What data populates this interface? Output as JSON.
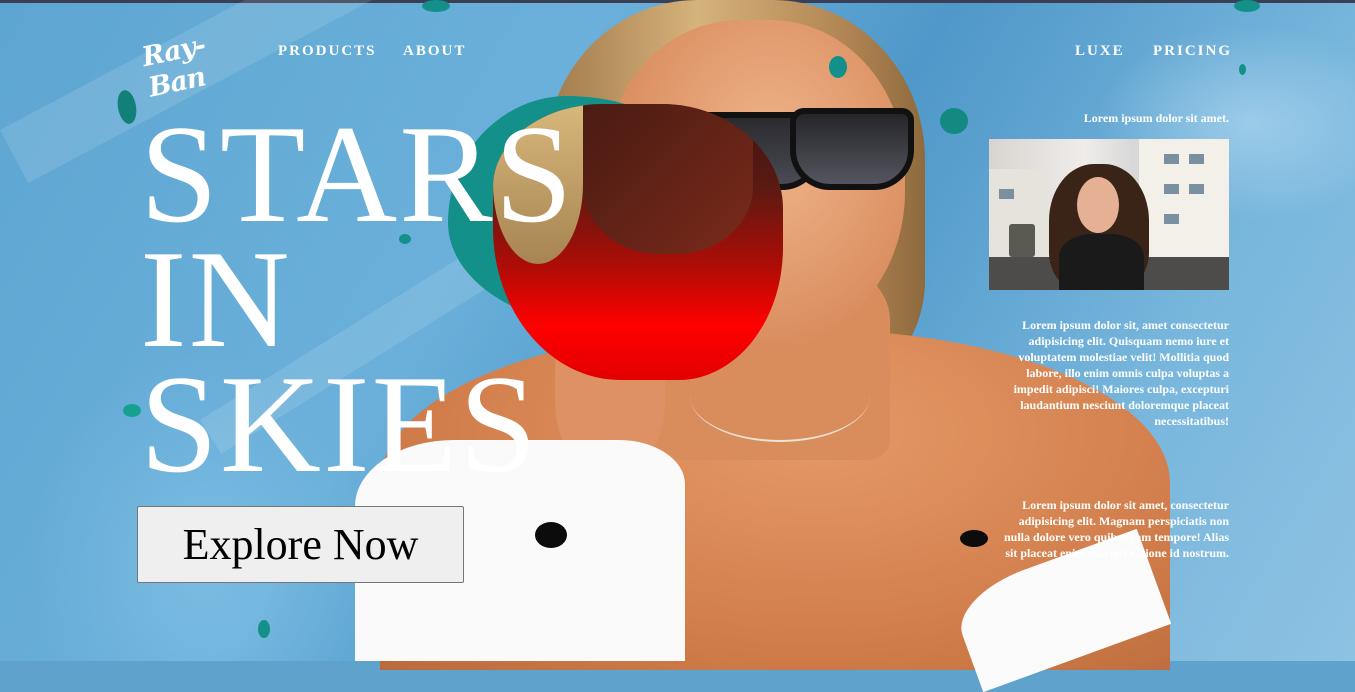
{
  "brand": {
    "logo_text": "Ray-Ban"
  },
  "nav": {
    "left": [
      "PRODUCTS",
      "ABOUT"
    ],
    "right": [
      "LUXE",
      "PRICING"
    ]
  },
  "hero": {
    "headline_lines": [
      "STARS",
      "IN",
      "SKIES"
    ],
    "cta_label": "Explore Now"
  },
  "aside": {
    "caption": "Lorem ipsum dolor sit amet.",
    "paragraph_1": "Lorem ipsum dolor sit, amet consectetur adipisicing elit. Quisquam nemo iure et voluptatem molestiae velit! Mollitia quod labore, illo enim omnis culpa voluptas a impedit adipisci! Maiores culpa, excepturi laudantium nesciunt doloremque placeat necessitatibus!",
    "paragraph_2": "Lorem ipsum dolor sit amet, consectetur adipisicing elit. Magnam perspiciatis non nulla dolore vero quibusdam tempore! Alias sit placeat enim suscipit ratione id nostrum."
  },
  "colors": {
    "background": "#5fa3cc",
    "accent_teal": "#14908a",
    "text": "#ffffff",
    "button_bg": "#efefef"
  }
}
